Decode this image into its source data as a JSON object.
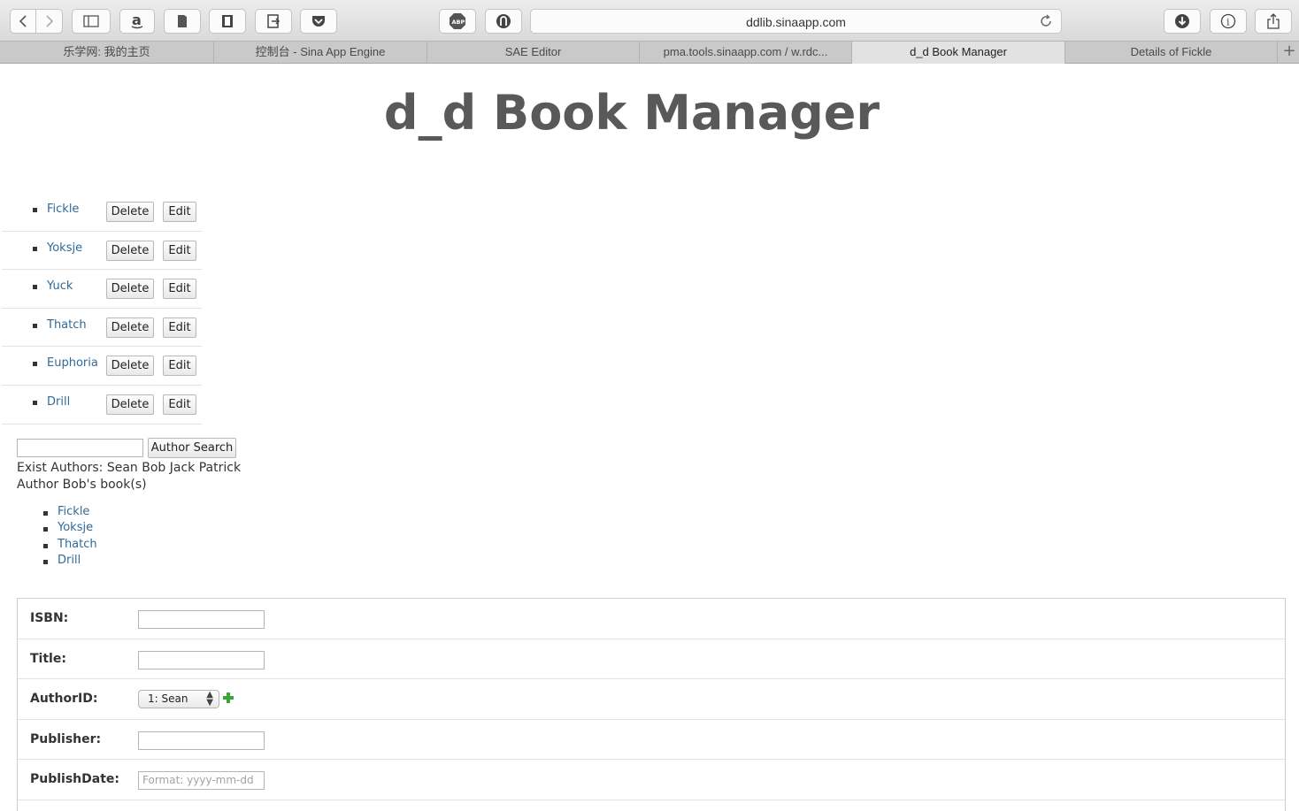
{
  "browser": {
    "url": "ddlib.sinaapp.com",
    "toolbar_icons": [
      "back-icon",
      "forward-icon",
      "sidebar-icon",
      "amazon-icon",
      "bookmark-icon",
      "reader-icon",
      "share-out-icon",
      "pocket-icon",
      "adblock-icon",
      "ghostery-icon",
      "reload-icon",
      "download-icon",
      "info-icon",
      "share-icon"
    ],
    "tabs": [
      {
        "label": "乐学网: 我的主页",
        "active": false
      },
      {
        "label": "控制台 - Sina App Engine",
        "active": false
      },
      {
        "label": "SAE Editor",
        "active": false
      },
      {
        "label": "pma.tools.sinaapp.com / w.rdc...",
        "active": false
      },
      {
        "label": "d_d Book Manager",
        "active": true
      },
      {
        "label": "Details of Fickle",
        "active": false
      }
    ],
    "new_tab": "+"
  },
  "page": {
    "title": "d_d Book Manager",
    "books": [
      {
        "title": "Fickle",
        "delete_label": "Delete",
        "edit_label": "Edit"
      },
      {
        "title": "Yoksje",
        "delete_label": "Delete",
        "edit_label": "Edit"
      },
      {
        "title": "Yuck",
        "delete_label": "Delete",
        "edit_label": "Edit"
      },
      {
        "title": "Thatch",
        "delete_label": "Delete",
        "edit_label": "Edit"
      },
      {
        "title": "Euphoria",
        "delete_label": "Delete",
        "edit_label": "Edit"
      },
      {
        "title": "Drill",
        "delete_label": "Delete",
        "edit_label": "Edit"
      }
    ],
    "search": {
      "value": "",
      "button_label": "Author Search"
    },
    "exist_authors": "Exist Authors: Sean Bob Jack Patrick",
    "author_books_heading": "Author Bob's book(s)",
    "author_books": [
      "Fickle",
      "Yoksje",
      "Thatch",
      "Drill"
    ],
    "form": {
      "isbn_label": "ISBN:",
      "title_label": "Title:",
      "authorid_label": "AuthorID:",
      "authorid_selected": "1: Sean",
      "publisher_label": "Publisher:",
      "publishdate_label": "PublishDate:",
      "publishdate_placeholder": "Format: yyyy-mm-dd"
    }
  },
  "colors": {
    "link": "#2f6a98",
    "title": "#595959",
    "plus": "#3aa63a"
  }
}
